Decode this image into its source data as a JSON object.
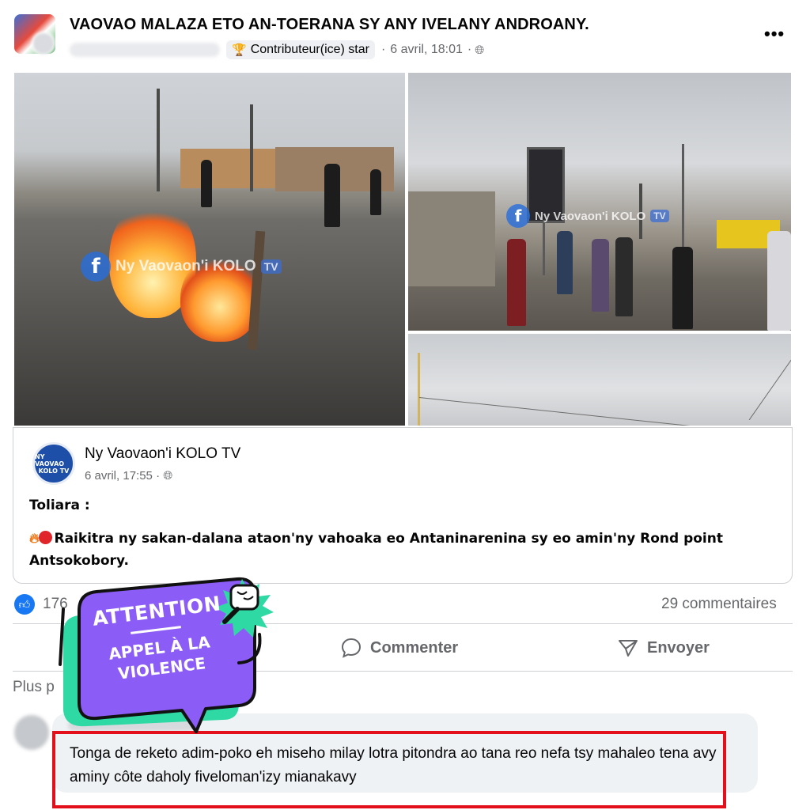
{
  "post_header": {
    "group_title": "VAOVAO MALAZA ETO AN-TOERANA SY ANY IVELANY ANDROANY.",
    "badge_label": "Contributeur(ice) star",
    "timestamp": "6 avril, 18:01",
    "separator": "·"
  },
  "photos": {
    "watermark": "Ny Vaovaon'i KOLO",
    "watermark_tv": "TV"
  },
  "shared_post": {
    "page_name": "Ny Vaovaon'i KOLO TV",
    "avatar_text_1": "NY VAOVAO",
    "avatar_text_2": "KOLO TV",
    "timestamp": "6 avril, 17:55",
    "location_line": "Toliara :",
    "body": "Raikitra ny sakan-dalana ataon'ny vahoaka eo Antaninarenina sy eo amin'ny Rond point Antsokobory."
  },
  "reactions": {
    "like_count": "176",
    "comments_count": "29 commentaires"
  },
  "actions": {
    "comment_label": "Commenter",
    "send_label": "Envoyer"
  },
  "comments_section": {
    "sort_label": "Plus p"
  },
  "comment": {
    "text": "Tonga de reketo adim-poko eh miseho milay lotra pitondra ao tana reo nefa tsy mahaleo tena avy aminy côte daholy fiveloman'izy mianakavy"
  },
  "sticker": {
    "title": "ATTENTION",
    "line1": "APPEL À LA",
    "line2": "VIOLENCE",
    "colors": {
      "purple": "#8b5cf6",
      "green": "#2fd9a4",
      "outline": "#111111"
    }
  },
  "colors": {
    "highlight_frame": "#e3101b",
    "facebook_blue": "#1877f2",
    "secondary_text": "#65676b"
  }
}
